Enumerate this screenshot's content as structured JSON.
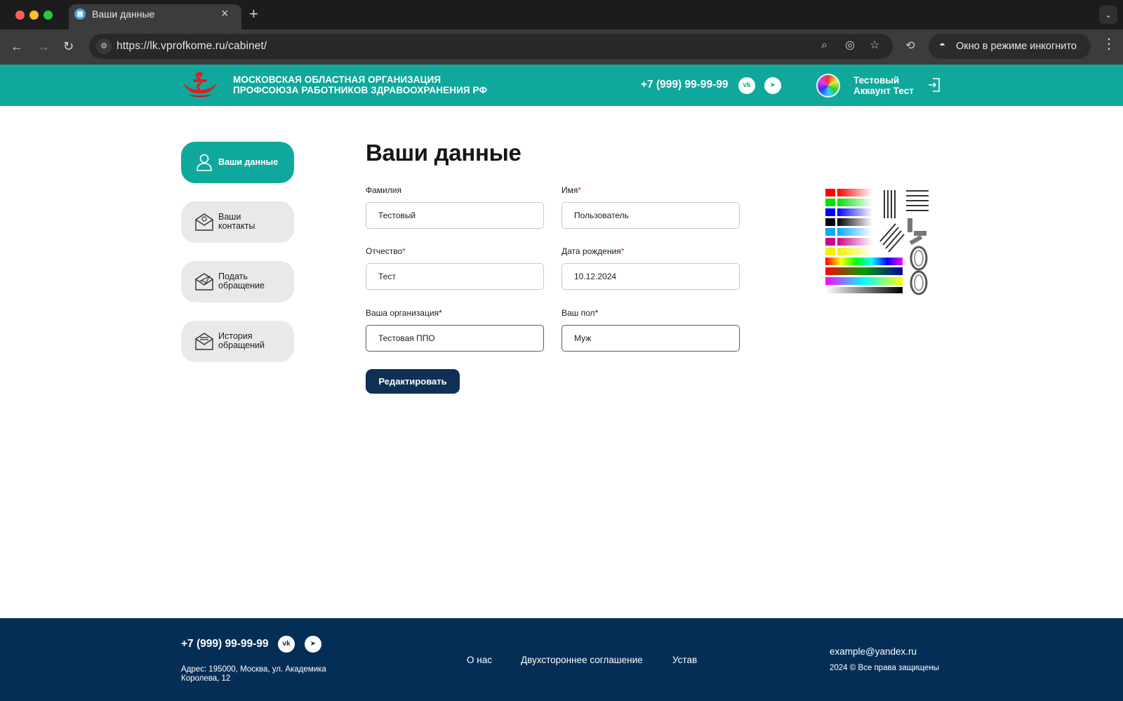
{
  "browser": {
    "tab_title": "Ваши данные",
    "url": "https://lk.vprofkome.ru/cabinet/",
    "incognito_label": "Окно в режиме инкогнито"
  },
  "header": {
    "org_line1": "МОСКОВСКАЯ ОБЛАСТНАЯ ОРГАНИЗАЦИЯ",
    "org_line2": "ПРОФСОЮЗА РАБОТНИКОВ ЗДРАВООХРАНЕНИЯ РФ",
    "phone": "+7 (999) 99-99-99",
    "user_line1": "Тестовый",
    "user_line2": "Аккаунт Тест"
  },
  "sidebar": {
    "items": [
      {
        "line1": "Ваши данные",
        "line2": ""
      },
      {
        "line1": "Ваши",
        "line2": "контакты"
      },
      {
        "line1": "Подать",
        "line2": "обращение"
      },
      {
        "line1": "История",
        "line2": "обращений"
      }
    ]
  },
  "main": {
    "title": "Ваши данные",
    "fields": {
      "last_name": {
        "label": "Фамилия",
        "value": "Тестовый"
      },
      "first_name": {
        "label": "Имя",
        "value": "Пользователь"
      },
      "patronymic": {
        "label": "Отчество",
        "value": "Тест"
      },
      "birth_date": {
        "label": "Дата рождения",
        "value": "10.12.2024"
      },
      "organization": {
        "label": "Ваша организация",
        "value": "Тестовая ППО"
      },
      "gender": {
        "label": "Ваш пол",
        "value": "Муж"
      }
    },
    "required_mark": "*",
    "edit_button": "Редактировать"
  },
  "footer": {
    "phone": "+7 (999) 99-99-99",
    "address_line1": "Адрес: 195000, Москва, ул. Академика",
    "address_line2": "Королева, 12",
    "links": [
      "О нас",
      "Двухстороннее соглашение",
      "Устав"
    ],
    "email": "example@yandex.ru",
    "copyright": "2024 © Все права защищены"
  },
  "colors": {
    "brand_teal": "#10a89c",
    "dark_navy": "#0f2f55",
    "footer_bg": "#052e57",
    "required_red": "#d52b2b"
  }
}
